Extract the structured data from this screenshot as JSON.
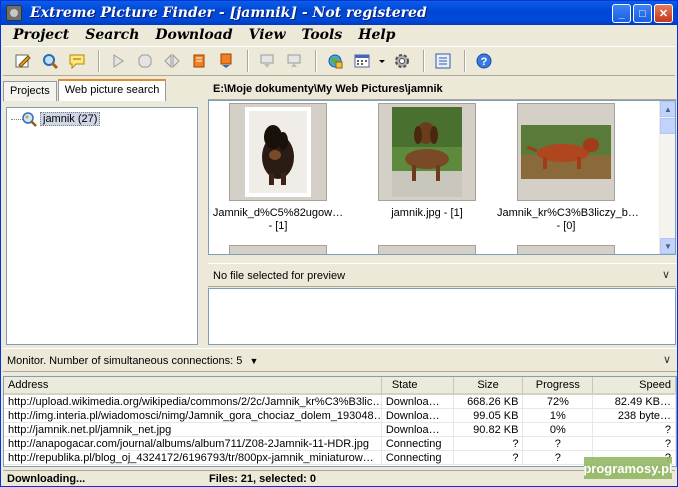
{
  "window": {
    "title": "Extreme Picture Finder - [jamnik] - Not registered"
  },
  "menu": [
    "Project",
    "Search",
    "Download",
    "View",
    "Tools",
    "Help"
  ],
  "toolbar": {
    "icons": [
      "edit-project-icon",
      "search-settings-icon",
      "comment-icon",
      "play-icon",
      "stop-icon",
      "pause-icon",
      "download-stop-icon",
      "download-resume-icon",
      "export-icon",
      "import-icon",
      "browser-icon",
      "calendar-icon",
      "options-icon",
      "list-view-icon",
      "help-icon"
    ]
  },
  "left_panel": {
    "tabs": [
      "Projects",
      "Web picture search"
    ],
    "active_tab": 1,
    "tree": [
      {
        "label": "jamnik (27)"
      }
    ]
  },
  "path": "E:\\Moje dokumenty\\My Web Pictures\\jamnik",
  "thumbnails": [
    {
      "name_line1": "Jamnik_d%C5%82ugow…",
      "name_line2": "- [1]"
    },
    {
      "name_line1": "jamnik.jpg - [1]",
      "name_line2": ""
    },
    {
      "name_line1": "Jamnik_kr%C3%B3liczy_b…",
      "name_line2": "- [0]"
    }
  ],
  "preview": {
    "label": "No file selected for preview"
  },
  "monitor": {
    "label": "Monitor. Number of simultaneous connections: 5",
    "columns": [
      "Address",
      "State",
      "Size",
      "Progress",
      "Speed"
    ],
    "rows": [
      {
        "address": "http://upload.wikimedia.org/wikipedia/commons/2/2c/Jamnik_kr%C3%B3lic…",
        "state": "Downloa…",
        "size": "668.26 KB",
        "progress": "72%",
        "speed": "82.49 KB…"
      },
      {
        "address": "http://img.interia.pl/wiadomosci/nimg/Jamnik_gora_chociaz_dolem_193048…",
        "state": "Downloa…",
        "size": "99.05 KB",
        "progress": "1%",
        "speed": "238 byte…"
      },
      {
        "address": "http://jamnik.net.pl/jamnik_net.jpg",
        "state": "Downloa…",
        "size": "90.82 KB",
        "progress": "0%",
        "speed": "?"
      },
      {
        "address": "http://anapogacar.com/journal/albums/album711/Z08-2Jamnik-11-HDR.jpg",
        "state": "Connecting",
        "size": "?",
        "progress": "?",
        "speed": "?"
      },
      {
        "address": "http://republika.pl/blog_oj_4324172/6196793/tr/800px-jamnik_miniaturow…",
        "state": "Connecting",
        "size": "?",
        "progress": "?",
        "speed": "?"
      }
    ]
  },
  "status": {
    "left": "Downloading...",
    "right": "Files: 21, selected: 0"
  },
  "watermark": "programosy.pl"
}
